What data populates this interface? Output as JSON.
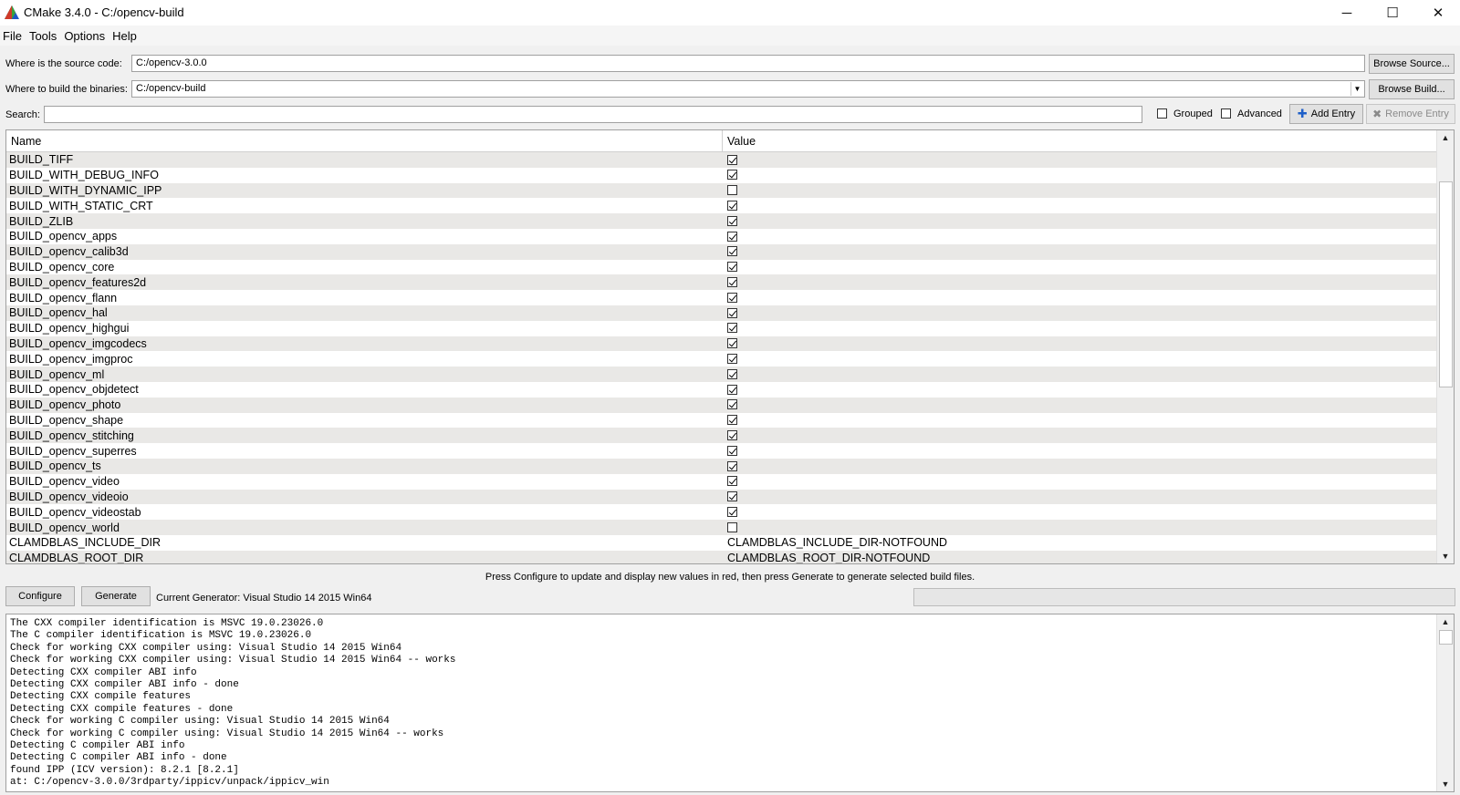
{
  "window": {
    "title": "CMake 3.4.0 - C:/opencv-build",
    "controls": {
      "minimize": "─",
      "maximize": "☐",
      "close": "✕"
    }
  },
  "menu": [
    "File",
    "Tools",
    "Options",
    "Help"
  ],
  "source": {
    "label": "Where is the source code:",
    "value": "C:/opencv-3.0.0",
    "button": "Browse Source..."
  },
  "build": {
    "label": "Where to build the binaries:",
    "value": "C:/opencv-build",
    "button": "Browse Build..."
  },
  "search": {
    "label": "Search:",
    "value": "",
    "grouped_label": "Grouped",
    "grouped": false,
    "advanced_label": "Advanced",
    "advanced": false,
    "add_entry": "Add Entry",
    "remove_entry": "Remove Entry"
  },
  "table": {
    "columns": [
      "Name",
      "Value"
    ],
    "rows": [
      {
        "name": "BUILD_TIFF",
        "checked": true
      },
      {
        "name": "BUILD_WITH_DEBUG_INFO",
        "checked": true
      },
      {
        "name": "BUILD_WITH_DYNAMIC_IPP",
        "checked": false
      },
      {
        "name": "BUILD_WITH_STATIC_CRT",
        "checked": true
      },
      {
        "name": "BUILD_ZLIB",
        "checked": true
      },
      {
        "name": "BUILD_opencv_apps",
        "checked": true
      },
      {
        "name": "BUILD_opencv_calib3d",
        "checked": true
      },
      {
        "name": "BUILD_opencv_core",
        "checked": true
      },
      {
        "name": "BUILD_opencv_features2d",
        "checked": true
      },
      {
        "name": "BUILD_opencv_flann",
        "checked": true
      },
      {
        "name": "BUILD_opencv_hal",
        "checked": true
      },
      {
        "name": "BUILD_opencv_highgui",
        "checked": true
      },
      {
        "name": "BUILD_opencv_imgcodecs",
        "checked": true
      },
      {
        "name": "BUILD_opencv_imgproc",
        "checked": true
      },
      {
        "name": "BUILD_opencv_ml",
        "checked": true
      },
      {
        "name": "BUILD_opencv_objdetect",
        "checked": true
      },
      {
        "name": "BUILD_opencv_photo",
        "checked": true
      },
      {
        "name": "BUILD_opencv_shape",
        "checked": true
      },
      {
        "name": "BUILD_opencv_stitching",
        "checked": true
      },
      {
        "name": "BUILD_opencv_superres",
        "checked": true
      },
      {
        "name": "BUILD_opencv_ts",
        "checked": true
      },
      {
        "name": "BUILD_opencv_video",
        "checked": true
      },
      {
        "name": "BUILD_opencv_videoio",
        "checked": true
      },
      {
        "name": "BUILD_opencv_videostab",
        "checked": true
      },
      {
        "name": "BUILD_opencv_world",
        "checked": false
      },
      {
        "name": "CLAMDBLAS_INCLUDE_DIR",
        "text": "CLAMDBLAS_INCLUDE_DIR-NOTFOUND"
      },
      {
        "name": "CLAMDBLAS_ROOT_DIR",
        "text": "CLAMDBLAS_ROOT_DIR-NOTFOUND"
      }
    ]
  },
  "hint": "Press Configure to update and display new values in red, then press Generate to generate selected build files.",
  "actions": {
    "configure": "Configure",
    "generate": "Generate",
    "generator": "Current Generator: Visual Studio 14 2015 Win64"
  },
  "output": [
    "The CXX compiler identification is MSVC 19.0.23026.0",
    "The C compiler identification is MSVC 19.0.23026.0",
    "Check for working CXX compiler using: Visual Studio 14 2015 Win64",
    "Check for working CXX compiler using: Visual Studio 14 2015 Win64 -- works",
    "Detecting CXX compiler ABI info",
    "Detecting CXX compiler ABI info - done",
    "Detecting CXX compile features",
    "Detecting CXX compile features - done",
    "Check for working C compiler using: Visual Studio 14 2015 Win64",
    "Check for working C compiler using: Visual Studio 14 2015 Win64 -- works",
    "Detecting C compiler ABI info",
    "Detecting C compiler ABI info - done",
    "found IPP (ICV version): 8.2.1 [8.2.1]",
    "at: C:/opencv-3.0.0/3rdparty/ippicv/unpack/ippicv_win"
  ],
  "colors": {
    "accent_blue": "#1e5fc8",
    "row_alt": "#e9e8e6",
    "background": "#f0f0f0"
  }
}
